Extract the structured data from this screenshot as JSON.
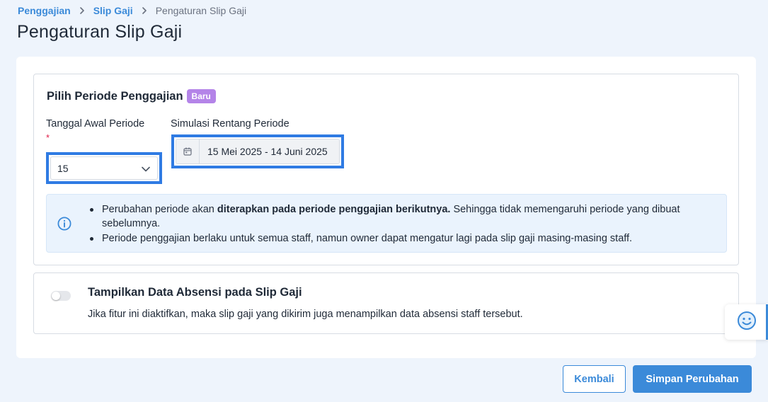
{
  "breadcrumb": {
    "items": [
      "Penggajian",
      "Slip Gaji"
    ],
    "current": "Pengaturan Slip Gaji"
  },
  "page": {
    "title": "Pengaturan Slip Gaji"
  },
  "period_section": {
    "title": "Pilih Periode Penggajian",
    "badge": "Baru",
    "start_label": "Tanggal Awal Periode",
    "required_mark": "*",
    "start_value": "15",
    "simulation_label": "Simulasi Rentang Periode",
    "simulation_value": "15 Mei 2025 - 14 Juni 2025",
    "info": {
      "line1_pre": "Perubahan periode akan ",
      "line1_bold": "diterapkan pada periode penggajian berikutnya.",
      "line1_post": " Sehingga tidak memengaruhi periode yang dibuat sebelumnya.",
      "line2": "Periode penggajian berlaku untuk semua staff, namun owner dapat mengatur lagi pada slip gaji masing-masing staff."
    }
  },
  "attendance_section": {
    "title": "Tampilkan Data Absensi pada Slip Gaji",
    "description": "Jika fitur ini diaktifkan, maka slip gaji yang dikirim juga menampilkan data absensi staff tersebut.",
    "toggle_on": false
  },
  "actions": {
    "back_label": "Kembali",
    "save_label": "Simpan Perubahan"
  },
  "colors": {
    "primary": "#3b8ad9",
    "badge": "#b484e8",
    "highlight_border": "#2f7be3",
    "background": "#eef4fc"
  },
  "icons": {
    "breadcrumb_separator": "chevron-right-icon",
    "select": "chevron-down-icon",
    "range": "calendar-icon",
    "info": "info-circle-icon",
    "chat": "smiley-face-icon"
  }
}
